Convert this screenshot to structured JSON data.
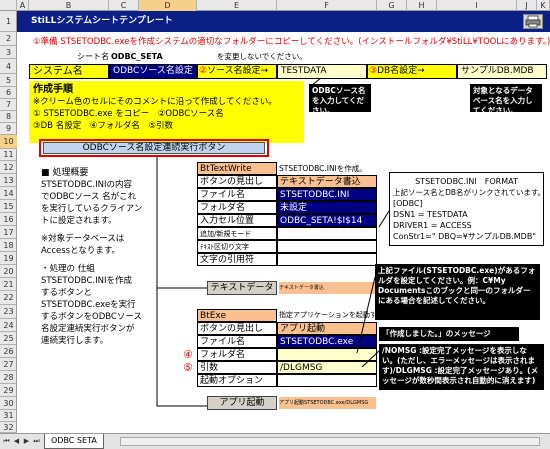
{
  "columns": [
    "A",
    "B",
    "C",
    "D",
    "E",
    "F",
    "G",
    "H",
    "I",
    "J",
    "K"
  ],
  "rows": [
    "1",
    "2",
    "3",
    "4",
    "5",
    "6",
    "7",
    "8",
    "9",
    "10",
    "11",
    "12",
    "13",
    "14",
    "15",
    "16",
    "17",
    "18",
    "19",
    "20",
    "21",
    "22",
    "23",
    "24",
    "25",
    "26",
    "27",
    "28",
    "29",
    "30",
    "31",
    "32"
  ],
  "selected_column": "D",
  "selected_row": "10",
  "header": {
    "title": "StiLLシステムシートテンプレート",
    "print_icon": "printer-icon"
  },
  "row2": {
    "circle": "①",
    "text": "準備 STSETODBC.exeを作成システムの適切なフォルダーにコピーしてください。(インストールフォルダ¥StiLL¥TOOLにあります。)"
  },
  "row3": {
    "sheet_name_label": "シート名",
    "sheet_name_value": "ODBC_SETA",
    "note": "を変更しないでください。"
  },
  "row4": {
    "system_name_label": "システム名",
    "system_name_value": "ODBCソース名設定",
    "circle2": "②",
    "source_label": "ソース名設定→",
    "source_value": "TESTDATA",
    "circle3": "③",
    "db_label": "DB名設定→",
    "db_value": "サンプルDB.MDB"
  },
  "procedure": {
    "title": "作成手順",
    "line1": "※クリーム色のセルにそのコメントに沿って作成してください。",
    "line2": "① STSETODBC.exe をコピー　②ODBCソース名",
    "line3": "③DB 名設定　④フォルダ名　⑤引数"
  },
  "callout_odbc": "ODBCソース名を入力してください。",
  "callout_db": "対象となるデータベース名を入力してください。",
  "main_button": "ODBCソース名設定連続実行ボタン",
  "overview": {
    "title": "■ 処理概要",
    "lines": [
      "STSETODBC.INIの内容",
      "でODBCソース 名がこれ",
      "を実行しているクライアン",
      "トに設定されます。",
      "",
      "※対象データベースは",
      "Accessとなります。",
      "",
      "・処理の 仕組",
      "STSETODBC.INIを作成",
      "するボタンと",
      "STSETODBC.exeを実行",
      "するボタンをODBCソース",
      "名設定連続実行ボタンが",
      "連続実行します。"
    ]
  },
  "bt_textwrite": {
    "title": "BtTextWrite",
    "note": "STSETODBC.INIを作成。",
    "rows": [
      {
        "label": "ボタンの見出し",
        "value": "テキストデータ書込"
      },
      {
        "label": "ファイル名",
        "value": "STSETODBC.INI"
      },
      {
        "label": "フォルダ名",
        "value": "未設定"
      },
      {
        "label": "入力セル位置",
        "value": "ODBC_SETA!$I$14"
      },
      {
        "label": "追加/新規モード",
        "value": ""
      },
      {
        "label": "ﾃｷｽﾄ区切り文字",
        "value": ""
      },
      {
        "label": "文字の引用符",
        "value": ""
      }
    ],
    "button": "テキストデータ",
    "button_note": "テキストデータ書込"
  },
  "ini_box": {
    "title1": "STSETODBC.INI　FORMAT",
    "title2": "上記ソース名とDB名がリンクされています。",
    "lines": [
      "[ODBC]",
      "DSN1 = TESTDATA",
      "DRIVER1 = ACCESS",
      "ConStr1=\" DBQ=¥サンプルDB.MDB\""
    ]
  },
  "callout_file": "上記ファイル(STSETODBC.exe)があるフォルダを設定してください。例：C¥My Documentsこのブックと同一のフォルダーにある場合を記述してください。",
  "callout_msg1": "「作成しました。」のメッセージ",
  "callout_msg2": "/NOMSG :設定完了メッセージを表示しない。(ただし、エラーメッセージは表示されます)/DLGMSG :設定完了メッセージあり。(メッセージが数秒間表示され自動的に消えます)",
  "bt_exe": {
    "title": "BtExe",
    "note": "指定アプリケーションを起動する",
    "rows": [
      {
        "label": "ボタンの見出し",
        "value": "アプリ起動"
      },
      {
        "label": "ファイル名",
        "value": "STSETODBC.exe"
      },
      {
        "label": "フォルダ名",
        "value": "",
        "circle": "④"
      },
      {
        "label": "引数",
        "value": "/DLGMSG",
        "circle": "⑤"
      },
      {
        "label": "起動オプション",
        "value": ""
      }
    ],
    "button": "アプリ起動",
    "button_note": "アプリ起動STSETODBC.exe/DLGMSG"
  },
  "tabs": {
    "sheet": "ODBC SETA"
  }
}
